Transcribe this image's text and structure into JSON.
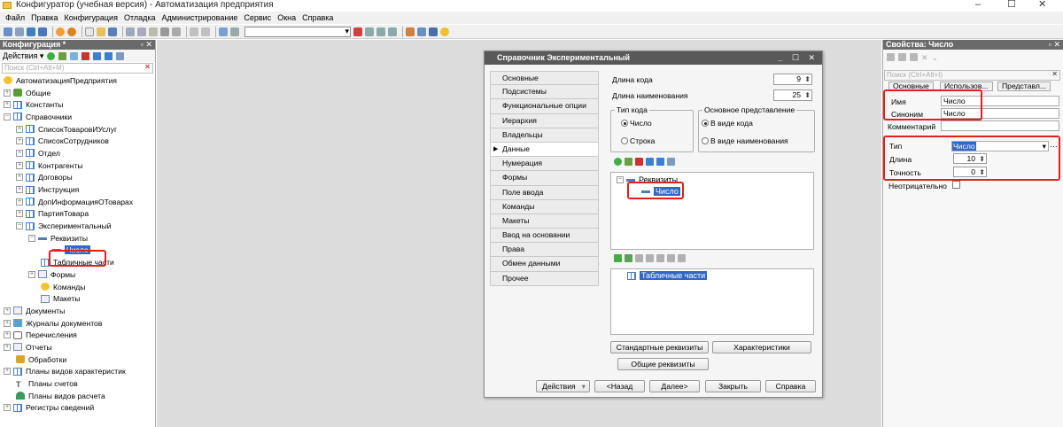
{
  "window": {
    "title": "Конфигуратор (учебная версия) - Автоматизация предприятия",
    "min": "–",
    "max": "☐",
    "close": "✕"
  },
  "menu": [
    "Файл",
    "Правка",
    "Конфигурация",
    "Отладка",
    "Администрирование",
    "Сервис",
    "Окна",
    "Справка"
  ],
  "left_panel": {
    "title": "Конфигурация *",
    "actions_label": "Действия ▾",
    "search_placeholder": "Поиск (Ctrl+Alt+M)",
    "tree": [
      {
        "label": "АвтоматизацияПредприятия",
        "icon": "config-icon"
      },
      {
        "label": "Общие",
        "icon": "common-icon"
      },
      {
        "label": "Константы",
        "icon": "constants-icon"
      },
      {
        "label": "Справочники",
        "icon": "catalog-icon"
      },
      {
        "label": "СписокТоваровИУслуг",
        "icon": "catalog-icon"
      },
      {
        "label": "СписокСотрудников",
        "icon": "catalog-icon"
      },
      {
        "label": "Отдел",
        "icon": "catalog-icon"
      },
      {
        "label": "Контрагенты",
        "icon": "catalog-icon"
      },
      {
        "label": "Договоры",
        "icon": "catalog-icon"
      },
      {
        "label": "Инструкция",
        "icon": "catalog-icon"
      },
      {
        "label": "ДопИнформацияОТоварах",
        "icon": "catalog-icon"
      },
      {
        "label": "ПартияТовара",
        "icon": "catalog-icon"
      },
      {
        "label": "Экспериментальный",
        "icon": "catalog-icon"
      },
      {
        "label": "Реквизиты",
        "icon": "attributes-icon"
      },
      {
        "label": "Число",
        "icon": "attribute-icon"
      },
      {
        "label": "Табличные части",
        "icon": "tabular-icon"
      },
      {
        "label": "Формы",
        "icon": "forms-icon"
      },
      {
        "label": "Команды",
        "icon": "commands-icon"
      },
      {
        "label": "Макеты",
        "icon": "templates-icon"
      },
      {
        "label": "Документы",
        "icon": "documents-icon"
      },
      {
        "label": "Журналы документов",
        "icon": "journals-icon"
      },
      {
        "label": "Перечисления",
        "icon": "enums-icon"
      },
      {
        "label": "Отчеты",
        "icon": "reports-icon"
      },
      {
        "label": "Обработки",
        "icon": "processing-icon"
      },
      {
        "label": "Планы видов характеристик",
        "icon": "charttypes-icon"
      },
      {
        "label": "Планы счетов",
        "icon": "accounts-icon"
      },
      {
        "label": "Планы видов расчета",
        "icon": "calc-icon"
      },
      {
        "label": "Регистры сведений",
        "icon": "registers-icon"
      }
    ]
  },
  "dialog": {
    "title": "Справочник Экспериментальный",
    "controls": "_ ☐ ✕",
    "nav": [
      "Основные",
      "Подсистемы",
      "Функциональные опции",
      "Иерархия",
      "Владельцы",
      "Данные",
      "Нумерация",
      "Формы",
      "Поле ввода",
      "Команды",
      "Макеты",
      "Ввод на основании",
      "Права",
      "Обмен данными",
      "Прочее"
    ],
    "active_nav": "Данные",
    "code_length_label": "Длина кода",
    "code_length": "9",
    "name_length_label": "Длина наименования",
    "name_length": "25",
    "code_type_legend": "Тип кода",
    "code_type_number": "Число",
    "code_type_string": "Строка",
    "main_repr_legend": "Основное представление",
    "main_repr_code": "В виде кода",
    "main_repr_name": "В виде наименования",
    "attributes_root": "Реквизиты",
    "attribute_selected": "Число",
    "tabular_root": "Табличные части",
    "btn_standard": "Стандартные реквизиты",
    "btn_characteristics": "Характеристики",
    "btn_common": "Общие реквизиты",
    "btn_actions": "Действия",
    "btn_back": "<Назад",
    "btn_next": "Далее>",
    "btn_close": "Закрыть",
    "btn_help": "Справка"
  },
  "properties": {
    "title": "Свойства: Число",
    "search_placeholder": "Поиск (Ctrl+Alt+I)",
    "tabs": [
      "Основные",
      "Использов...",
      "Представл..."
    ],
    "name_label": "Имя",
    "name_value": "Число",
    "synonym_label": "Синоним",
    "synonym_value": "Число",
    "comment_label": "Комментарий",
    "type_label": "Тип",
    "type_value": "Число",
    "length_label": "Длина",
    "length_value": "10",
    "precision_label": "Точность",
    "precision_value": "0",
    "nonnegative_label": "Неотрицательно"
  },
  "colors": {
    "selection": "#3168c5",
    "highlight_box": "#e02020",
    "panel_header": "#6a6a6a"
  }
}
